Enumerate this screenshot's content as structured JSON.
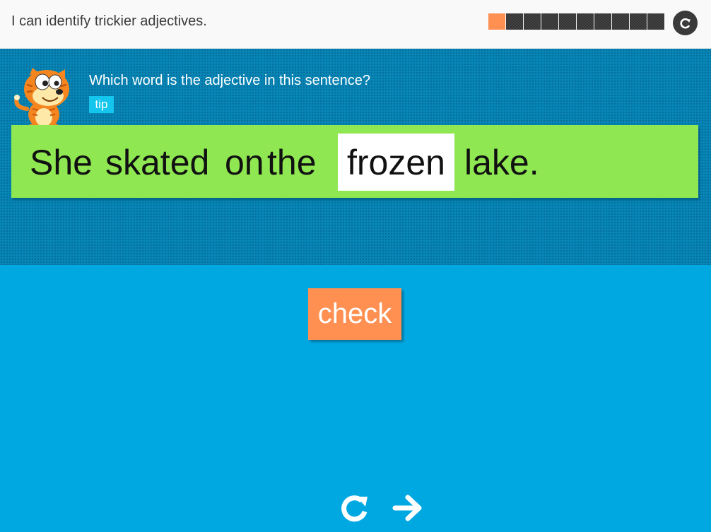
{
  "header": {
    "objective": "I can identify trickier adjectives.",
    "progress": {
      "total": 10,
      "completed": 1
    },
    "reset_icon": "reset-icon"
  },
  "question": {
    "prompt": "Which word is the adjective in this sentence?",
    "tip_label": "tip",
    "sentence_before": [
      "She",
      "skated",
      "on",
      "the"
    ],
    "answer_word": "frozen",
    "sentence_after": "lake."
  },
  "actions": {
    "check_label": "check",
    "retry_icon": "retry-icon",
    "next_icon": "next-arrow-icon"
  },
  "colors": {
    "accent": "#ff9052",
    "panel": "#0786b6",
    "background": "#00a8e2",
    "sentence_bg": "#8fe752",
    "tip": "#14c6ee"
  }
}
